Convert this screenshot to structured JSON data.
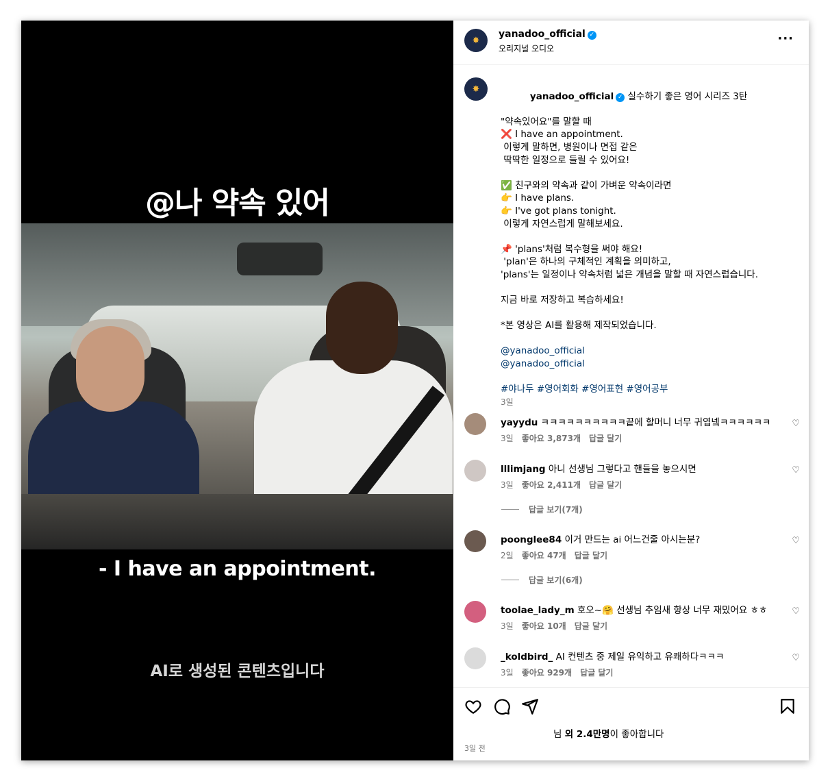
{
  "video": {
    "caption_top": "@나 약속 있어",
    "caption_mid": "- I have an appointment.",
    "caption_bottom": "AI로 생성된 콘텐츠입니다"
  },
  "header": {
    "username": "yanadoo_official",
    "subtitle": "오리지널 오디오",
    "more": "···"
  },
  "post": {
    "username": "yanadoo_official",
    "title": "실수하기 좋은 영어 시리즈 3탄",
    "lines": [
      "",
      "\"약속있어요\"를 말할 때",
      "❌ I have an appointment.",
      " 이렇게 말하면, 병원이나 면접 같은",
      " 딱딱한 일정으로 들릴 수 있어요!",
      "",
      "✅ 친구와의 약속과 같이 가벼운 약속이라면",
      "👉 I have plans.",
      "👉 I've got plans tonight.",
      " 이렇게 자연스럽게 말해보세요.",
      "",
      "📌 'plans'처럼 복수형을 써야 해요!",
      " 'plan'은 하나의 구체적인 계획을 의미하고,",
      "'plans'는 일정이나 약속처럼 넓은 개념을 말할 때 자연스럽습니다.",
      "",
      "지금 바로 저장하고 복습하세요!",
      "",
      "*본 영상은 AI를 활용해 제작되었습니다.",
      ""
    ],
    "mentions": [
      "@yanadoo_official",
      "@yanadoo_official"
    ],
    "hashtags": "#야나두 #영어회화 #영어표현 #영어공부",
    "age": "3일"
  },
  "comments": [
    {
      "user": "yayydu",
      "text": "ㅋㅋㅋㅋㅋㅋㅋㅋㅋㅋ끝에 할머니 너무 귀엽넼ㅋㅋㅋㅋㅋㅋ",
      "age": "3일",
      "likes": "좋아요 3,873개",
      "reply": "답글 달기",
      "avatar_color": "#a58c7a"
    },
    {
      "user": "lllimjang",
      "text": "아니 선생님 그렇다고 핸들을 놓으시면",
      "age": "3일",
      "likes": "좋아요 2,411개",
      "reply": "답글 달기",
      "avatar_color": "#cfc7c4",
      "view_replies": "답글 보기(7개)"
    },
    {
      "user": "poonglee84",
      "text": "이거 만드는 ai 어느건줄 아시는분?",
      "age": "2일",
      "likes": "좋아요 47개",
      "reply": "답글 달기",
      "avatar_color": "#6b5a50",
      "view_replies": "답글 보기(6개)"
    },
    {
      "user": "toolae_lady_m",
      "text": "호오~🤗 선생님 추임새 항상 너무 재밌어요 ㅎㅎ",
      "age": "3일",
      "likes": "좋아요 10개",
      "reply": "답글 달기",
      "avatar_color": "#d35f7f"
    },
    {
      "user": "_koldbird_",
      "text": "AI 컨텐츠 중 제일 유익하고 유쾌하다ㅋㅋㅋ",
      "age": "3일",
      "likes": "좋아요 929개",
      "reply": "답글 달기",
      "avatar_color": "#dbdbdb"
    }
  ],
  "footer": {
    "likes_prefix": "님 ",
    "likes_bold": "외 2.4만명",
    "likes_suffix": "이 좋아합니다",
    "posted": "3일 전"
  },
  "icons": {
    "like": "heart-icon",
    "comment": "comment-icon",
    "share": "send-icon",
    "save": "bookmark-icon",
    "verified": "verified-badge-icon"
  },
  "colors": {
    "link": "#00376b",
    "verified": "#0095f6",
    "meta": "#737373"
  }
}
